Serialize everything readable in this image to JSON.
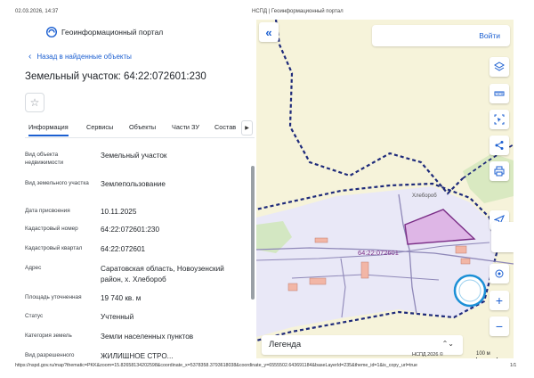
{
  "print_header": {
    "datetime": "02.03.2026, 14:37",
    "title": "НСПД | Геоинформационный портал"
  },
  "portal": {
    "name": "Геоинформационный портал",
    "logo_icon": "nspd-logo-icon",
    "accent_color": "#1b5fd1"
  },
  "back_link": {
    "label": "Назад в найденные объекты"
  },
  "object_title": "Земельный участок: 64:22:072601:230",
  "favorite_icon": "star-icon",
  "tabs": [
    {
      "label": "Информация",
      "active": true
    },
    {
      "label": "Сервисы",
      "active": false
    },
    {
      "label": "Объекты",
      "active": false
    },
    {
      "label": "Части ЗУ",
      "active": false
    },
    {
      "label": "Состав",
      "active": false
    }
  ],
  "properties": [
    {
      "label": "Вид объекта недвижимости",
      "value": "Земельный участок"
    },
    {
      "label": "Вид земельного участка",
      "value": "Землепользование"
    },
    {
      "label": "Дата присвоения",
      "value": "10.11.2025"
    },
    {
      "label": "Кадастровый номер",
      "value": "64:22:072601:230"
    },
    {
      "label": "Кадастровый квартал",
      "value": "64:22:072601"
    },
    {
      "label": "Адрес",
      "value": "Саратовская область, Новоузенский район, х. Хлебороб"
    },
    {
      "label": "Площадь уточненная",
      "value": "19 740 кв. м"
    },
    {
      "label": "Статус",
      "value": "Учтенный"
    },
    {
      "label": "Категория земель",
      "value": "Земли населенных пунктов"
    },
    {
      "label": "Вид разрешенного",
      "value": "ЖИЛИЩНОЕ СТРО..."
    }
  ],
  "map": {
    "login_label": "Войти",
    "collapse_icon": "double-chevron-left-icon",
    "tools": [
      "layers-icon",
      "ruler-icon",
      "select-area-icon",
      "share-icon",
      "print-icon",
      "locate-icon",
      "geolocation-icon"
    ],
    "parcel_label": "64:22:072601",
    "place_label": "Хлебороб",
    "legend_label": "Легенда",
    "attribution": "НСПД 2026 ©",
    "scale_label": "100 м",
    "zoom_in": "+",
    "zoom_out": "−",
    "colors": {
      "background": "#f6f3da",
      "settlement_fill": "#e9e8f7",
      "parcel_fill": "#d9a6e0",
      "parcel_stroke": "#7a2d86",
      "boundary": "#1e2a7a"
    }
  },
  "print_footer": {
    "url": "https://nspd.gov.ru/map?thematic=PKK&zoom=15.82658134202598&coordinate_x=5378358.3793618038&coordinate_y=6555502.643691184&baseLayerId=235&theme_id=1&is_copy_url=true",
    "page": "1/1"
  }
}
